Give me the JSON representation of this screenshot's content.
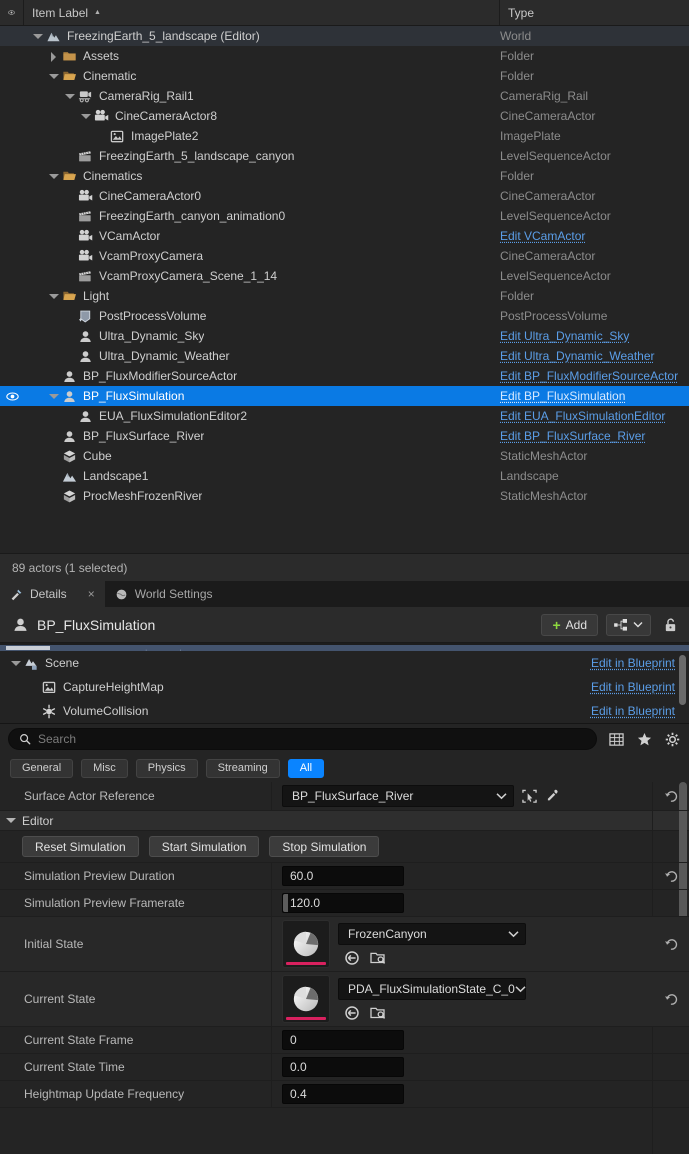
{
  "outliner": {
    "columns": {
      "eye_icon": "eye-icon",
      "item_label": "Item Label",
      "sort_asc": "▲",
      "type": "Type"
    },
    "rows": [
      {
        "label": "FreezingEarth_5_landscape (Editor)",
        "type": "World",
        "depth": 1,
        "twisty": "down",
        "icon": "world-icon",
        "selected": false,
        "root": true,
        "link": false,
        "eye": false
      },
      {
        "label": "Assets",
        "type": "Folder",
        "depth": 2,
        "twisty": "right",
        "icon": "folder-closed-icon",
        "selected": false,
        "root": false,
        "link": false,
        "eye": false
      },
      {
        "label": "Cinematic",
        "type": "Folder",
        "depth": 2,
        "twisty": "down",
        "icon": "folder-open-icon",
        "selected": false,
        "root": false,
        "link": false,
        "eye": false
      },
      {
        "label": "CameraRig_Rail1",
        "type": "CameraRig_Rail",
        "depth": 3,
        "twisty": "down",
        "icon": "camera-rig-icon",
        "selected": false,
        "root": false,
        "link": false,
        "eye": false
      },
      {
        "label": "CineCameraActor8",
        "type": "CineCameraActor",
        "depth": 4,
        "twisty": "down",
        "icon": "cine-camera-icon",
        "selected": false,
        "root": false,
        "link": false,
        "eye": false
      },
      {
        "label": "ImagePlate2",
        "type": "ImagePlate",
        "depth": 5,
        "twisty": "none",
        "icon": "image-plate-icon",
        "selected": false,
        "root": false,
        "link": false,
        "eye": false
      },
      {
        "label": "FreezingEarth_5_landscape_canyon",
        "type": "LevelSequenceActor",
        "depth": 3,
        "twisty": "none",
        "icon": "clapperboard-icon",
        "selected": false,
        "root": false,
        "link": false,
        "eye": false
      },
      {
        "label": "Cinematics",
        "type": "Folder",
        "depth": 2,
        "twisty": "down",
        "icon": "folder-open-icon",
        "selected": false,
        "root": false,
        "link": false,
        "eye": false
      },
      {
        "label": "CineCameraActor0",
        "type": "CineCameraActor",
        "depth": 3,
        "twisty": "none",
        "icon": "cine-camera-icon",
        "selected": false,
        "root": false,
        "link": false,
        "eye": false
      },
      {
        "label": "FreezingEarth_canyon_animation0",
        "type": "LevelSequenceActor",
        "depth": 3,
        "twisty": "none",
        "icon": "clapperboard-icon",
        "selected": false,
        "root": false,
        "link": false,
        "eye": false
      },
      {
        "label": "VCamActor",
        "type": "Edit VCamActor",
        "depth": 3,
        "twisty": "none",
        "icon": "cine-camera-icon",
        "selected": false,
        "root": false,
        "link": true,
        "eye": false
      },
      {
        "label": "VcamProxyCamera",
        "type": "CineCameraActor",
        "depth": 3,
        "twisty": "none",
        "icon": "cine-camera-icon",
        "selected": false,
        "root": false,
        "link": false,
        "eye": false
      },
      {
        "label": "VcamProxyCamera_Scene_1_14",
        "type": "LevelSequenceActor",
        "depth": 3,
        "twisty": "none",
        "icon": "clapperboard-icon",
        "selected": false,
        "root": false,
        "link": false,
        "eye": false
      },
      {
        "label": "Light",
        "type": "Folder",
        "depth": 2,
        "twisty": "down",
        "icon": "folder-open-icon",
        "selected": false,
        "root": false,
        "link": false,
        "eye": false
      },
      {
        "label": "PostProcessVolume",
        "type": "PostProcessVolume",
        "depth": 3,
        "twisty": "none",
        "icon": "post-process-volume-icon",
        "selected": false,
        "root": false,
        "link": false,
        "eye": false
      },
      {
        "label": "Ultra_Dynamic_Sky",
        "type": "Edit Ultra_Dynamic_Sky",
        "depth": 3,
        "twisty": "none",
        "icon": "blueprint-actor-icon",
        "selected": false,
        "root": false,
        "link": true,
        "eye": false
      },
      {
        "label": "Ultra_Dynamic_Weather",
        "type": "Edit Ultra_Dynamic_Weather",
        "depth": 3,
        "twisty": "none",
        "icon": "blueprint-actor-icon",
        "selected": false,
        "root": false,
        "link": true,
        "eye": false
      },
      {
        "label": "BP_FluxModifierSourceActor",
        "type": "Edit BP_FluxModifierSourceActor",
        "depth": 2,
        "twisty": "none",
        "icon": "blueprint-actor-icon",
        "selected": false,
        "root": false,
        "link": true,
        "eye": false
      },
      {
        "label": "BP_FluxSimulation",
        "type": "Edit BP_FluxSimulation",
        "depth": 2,
        "twisty": "down",
        "icon": "blueprint-actor-icon",
        "selected": true,
        "root": false,
        "link": true,
        "eye": true
      },
      {
        "label": "EUA_FluxSimulationEditor2",
        "type": "Edit EUA_FluxSimulationEditor",
        "depth": 3,
        "twisty": "none",
        "icon": "blueprint-actor-icon",
        "selected": false,
        "root": false,
        "link": true,
        "eye": false
      },
      {
        "label": "BP_FluxSurface_River",
        "type": "Edit BP_FluxSurface_River",
        "depth": 2,
        "twisty": "none",
        "icon": "blueprint-actor-icon",
        "selected": false,
        "root": false,
        "link": true,
        "eye": false
      },
      {
        "label": "Cube",
        "type": "StaticMeshActor",
        "depth": 2,
        "twisty": "none",
        "icon": "static-mesh-icon",
        "selected": false,
        "root": false,
        "link": false,
        "eye": false
      },
      {
        "label": "Landscape1",
        "type": "Landscape",
        "depth": 2,
        "twisty": "none",
        "icon": "landscape-icon",
        "selected": false,
        "root": false,
        "link": false,
        "eye": false
      },
      {
        "label": "ProcMeshFrozenRiver",
        "type": "StaticMeshActor",
        "depth": 2,
        "twisty": "none",
        "icon": "static-mesh-icon",
        "selected": false,
        "root": false,
        "link": false,
        "eye": false
      }
    ],
    "status": "89 actors (1 selected)"
  },
  "details": {
    "tabs": [
      {
        "label": "Details",
        "icon": "details-wrench-icon",
        "active": true,
        "closable": true,
        "close": "×"
      },
      {
        "label": "World Settings",
        "icon": "world-settings-icon",
        "active": false,
        "closable": false,
        "close": ""
      }
    ],
    "title": "BP_FluxSimulation",
    "title_icon": "blueprint-actor-icon",
    "add_button": "Add",
    "components": [
      {
        "label": "Scene",
        "link": "Edit in Blueprint",
        "depth": 1,
        "twisty": "down",
        "icon": "scene-root-icon"
      },
      {
        "label": "CaptureHeightMap",
        "link": "Edit in Blueprint",
        "depth": 2,
        "twisty": "none",
        "icon": "scene-capture-icon"
      },
      {
        "label": "VolumeCollision",
        "link": "Edit in Blueprint",
        "depth": 2,
        "twisty": "none",
        "icon": "collision-icon"
      }
    ],
    "search": {
      "placeholder": "Search",
      "value": "",
      "icon": "search-icon"
    },
    "search_tools": [
      "grid-view-icon",
      "favorites-star-icon",
      "settings-gear-icon"
    ],
    "filters": [
      {
        "label": "General",
        "active": false
      },
      {
        "label": "Misc",
        "active": false
      },
      {
        "label": "Physics",
        "active": false
      },
      {
        "label": "Streaming",
        "active": false
      },
      {
        "label": "All",
        "active": true
      }
    ],
    "properties": [
      {
        "kind": "combo",
        "name": "Surface Actor Reference",
        "value": "BP_FluxSurface_River",
        "extra_icons": [
          "browse-to-asset-icon",
          "eyedropper-picker-icon"
        ],
        "reset": true
      },
      {
        "kind": "category",
        "name": "Editor"
      },
      {
        "kind": "buttons",
        "buttons": [
          "Reset Simulation",
          "Start Simulation",
          "Stop Simulation"
        ]
      },
      {
        "kind": "number",
        "name": "Simulation Preview Duration",
        "value": "60.0",
        "spin": false,
        "reset": true
      },
      {
        "kind": "number",
        "name": "Simulation Preview Framerate",
        "value": "120.0",
        "spin": true,
        "reset": false
      },
      {
        "kind": "asset",
        "name": "Initial State",
        "value": "FrozenCanyon",
        "thumb": "pie-chart-thumbnail",
        "icons": [
          "use-selected-asset-icon",
          "browse-to-asset-icon"
        ],
        "reset": true
      },
      {
        "kind": "asset",
        "name": "Current State",
        "value": "PDA_FluxSimulationState_C_0",
        "thumb": "pie-chart-thumbnail",
        "icons": [
          "use-selected-asset-icon",
          "browse-to-asset-icon"
        ],
        "reset": true
      },
      {
        "kind": "number",
        "name": "Current State Frame",
        "value": "0",
        "spin": false,
        "reset": false
      },
      {
        "kind": "number",
        "name": "Current State Time",
        "value": "0.0",
        "spin": false,
        "reset": false
      },
      {
        "kind": "number",
        "name": "Heightmap Update Frequency",
        "value": "0.4",
        "spin": false,
        "reset": false
      }
    ]
  },
  "colors": {
    "selection_blue": "#0a7ae4",
    "link_blue": "#5b9ee8",
    "accent_chip": "#0a84ff",
    "thumb_underline": "#d9215f",
    "add_plus_green": "#8ed93f",
    "panel_bg": "#242424",
    "header_bg": "#2b2b2b"
  }
}
